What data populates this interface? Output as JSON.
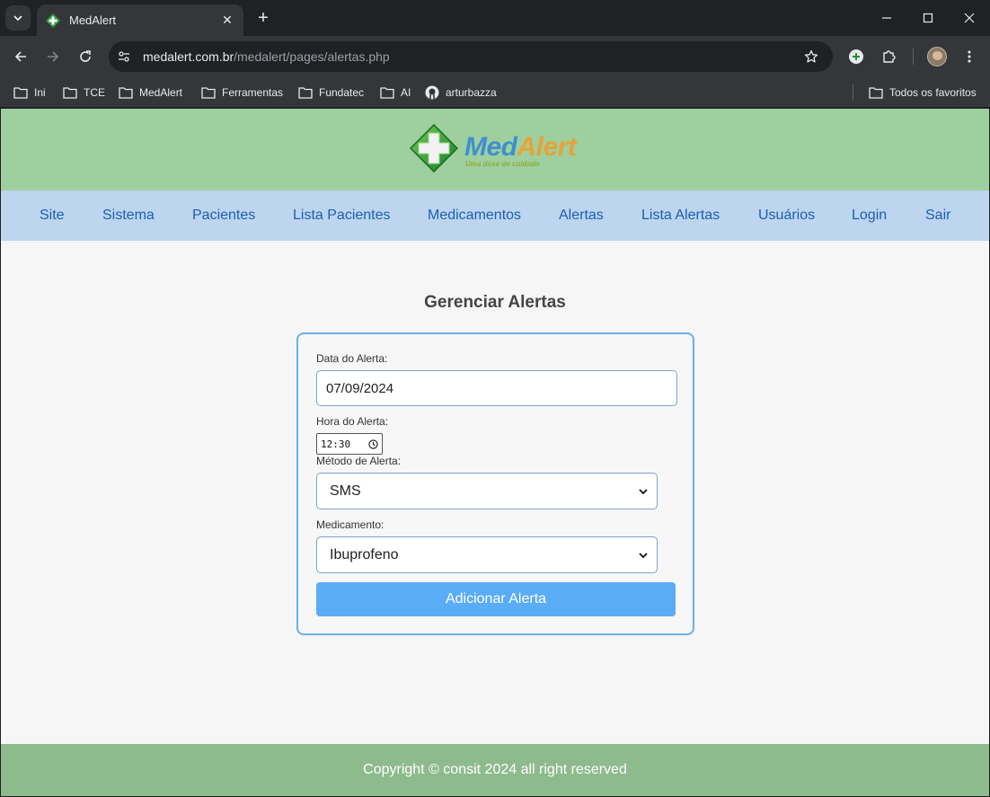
{
  "browser": {
    "tab_title": "MedAlert",
    "tab_close": "✕",
    "new_tab": "+",
    "url_host": "medalert.com.br",
    "url_path": "/medalert/pages/alertas.php",
    "bookmarks": [
      "Ini",
      "TCE",
      "MedAlert",
      "Ferramentas",
      "Fundatec",
      "AI",
      "arturbazza"
    ],
    "all_bookmarks": "Todos os favoritos"
  },
  "header": {
    "logo_med": "Med",
    "logo_alert": "Alert",
    "logo_slogan": "Uma dose de cuidado",
    "colors": {
      "hero": "#9ecf9e",
      "nav": "#bdd5ee",
      "link": "#1a5fb4"
    }
  },
  "nav": {
    "items": [
      "Site",
      "Sistema",
      "Pacientes",
      "Lista Pacientes",
      "Medicamentos",
      "Alertas",
      "Lista Alertas",
      "Usuários",
      "Login",
      "Sair"
    ]
  },
  "main": {
    "title": "Gerenciar Alertas",
    "form": {
      "date_label": "Data do Alerta:",
      "date_value": "07/09/2024",
      "time_label": "Hora do Alerta:",
      "time_value": "12:30",
      "method_label": "Método de Alerta:",
      "method_value": "SMS",
      "medication_label": "Medicamento:",
      "medication_value": "Ibuprofeno",
      "submit_label": "Adicionar Alerta",
      "accent": "#5aacf7"
    }
  },
  "footer": {
    "text": "Copyright © consit 2024 all right reserved",
    "color": "#8dbb8d"
  }
}
